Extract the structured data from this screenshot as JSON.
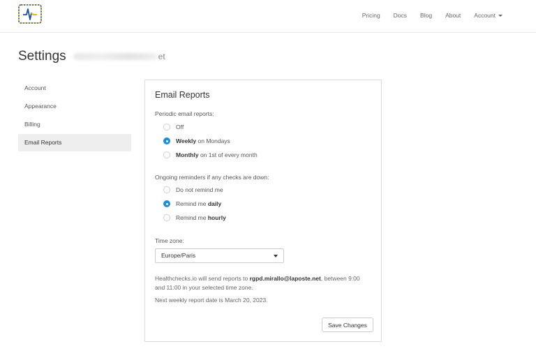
{
  "nav": {
    "links": [
      "Pricing",
      "Docs",
      "Blog",
      "About"
    ],
    "account_label": "Account"
  },
  "page": {
    "title": "Settings",
    "title_tail": "et"
  },
  "sidebar": {
    "items": [
      {
        "label": "Account"
      },
      {
        "label": "Appearance"
      },
      {
        "label": "Billing"
      },
      {
        "label": "Email Reports",
        "active": true
      }
    ]
  },
  "panel": {
    "title": "Email Reports",
    "periodic": {
      "label": "Periodic email reports:",
      "options": [
        {
          "bold": "",
          "text": "Off",
          "checked": false
        },
        {
          "bold": "Weekly",
          "text": " on Mondays",
          "checked": true
        },
        {
          "bold": "Monthly",
          "text": " on 1st of every month",
          "checked": false
        }
      ]
    },
    "reminders": {
      "label": "Ongoing reminders if any checks are down:",
      "options": [
        {
          "text": "Do not remind me",
          "bold": "",
          "checked": false
        },
        {
          "text": "Remind me ",
          "bold": "daily",
          "checked": true
        },
        {
          "text": "Remind me ",
          "bold": "hourly",
          "checked": false
        }
      ]
    },
    "timezone": {
      "label": "Time zone:",
      "value": "Europe/Paris"
    },
    "info": {
      "prefix": "Healthchecks.io will send reports to ",
      "email": "rgpd.mirallo@laposte.net",
      "suffix": ", between 9:00 and 11:00 in your selected time zone.",
      "next_report": "Next weekly report date is March 20, 2023."
    },
    "save_label": "Save Changes"
  },
  "colors": {
    "accent": "#1a8fdd",
    "active_bg": "#eeeeee"
  }
}
